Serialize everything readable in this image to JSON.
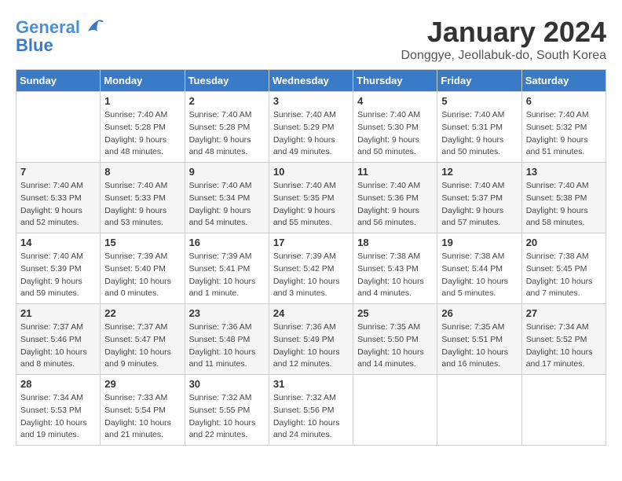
{
  "header": {
    "logo_line1": "General",
    "logo_line2": "Blue",
    "month_title": "January 2024",
    "subtitle": "Donggye, Jeollabuk-do, South Korea"
  },
  "weekdays": [
    "Sunday",
    "Monday",
    "Tuesday",
    "Wednesday",
    "Thursday",
    "Friday",
    "Saturday"
  ],
  "weeks": [
    [
      {
        "day": "",
        "sunrise": "",
        "sunset": "",
        "daylight": ""
      },
      {
        "day": "1",
        "sunrise": "Sunrise: 7:40 AM",
        "sunset": "Sunset: 5:28 PM",
        "daylight": "Daylight: 9 hours and 48 minutes."
      },
      {
        "day": "2",
        "sunrise": "Sunrise: 7:40 AM",
        "sunset": "Sunset: 5:28 PM",
        "daylight": "Daylight: 9 hours and 48 minutes."
      },
      {
        "day": "3",
        "sunrise": "Sunrise: 7:40 AM",
        "sunset": "Sunset: 5:29 PM",
        "daylight": "Daylight: 9 hours and 49 minutes."
      },
      {
        "day": "4",
        "sunrise": "Sunrise: 7:40 AM",
        "sunset": "Sunset: 5:30 PM",
        "daylight": "Daylight: 9 hours and 50 minutes."
      },
      {
        "day": "5",
        "sunrise": "Sunrise: 7:40 AM",
        "sunset": "Sunset: 5:31 PM",
        "daylight": "Daylight: 9 hours and 50 minutes."
      },
      {
        "day": "6",
        "sunrise": "Sunrise: 7:40 AM",
        "sunset": "Sunset: 5:32 PM",
        "daylight": "Daylight: 9 hours and 51 minutes."
      }
    ],
    [
      {
        "day": "7",
        "sunrise": "Sunrise: 7:40 AM",
        "sunset": "Sunset: 5:33 PM",
        "daylight": "Daylight: 9 hours and 52 minutes."
      },
      {
        "day": "8",
        "sunrise": "Sunrise: 7:40 AM",
        "sunset": "Sunset: 5:33 PM",
        "daylight": "Daylight: 9 hours and 53 minutes."
      },
      {
        "day": "9",
        "sunrise": "Sunrise: 7:40 AM",
        "sunset": "Sunset: 5:34 PM",
        "daylight": "Daylight: 9 hours and 54 minutes."
      },
      {
        "day": "10",
        "sunrise": "Sunrise: 7:40 AM",
        "sunset": "Sunset: 5:35 PM",
        "daylight": "Daylight: 9 hours and 55 minutes."
      },
      {
        "day": "11",
        "sunrise": "Sunrise: 7:40 AM",
        "sunset": "Sunset: 5:36 PM",
        "daylight": "Daylight: 9 hours and 56 minutes."
      },
      {
        "day": "12",
        "sunrise": "Sunrise: 7:40 AM",
        "sunset": "Sunset: 5:37 PM",
        "daylight": "Daylight: 9 hours and 57 minutes."
      },
      {
        "day": "13",
        "sunrise": "Sunrise: 7:40 AM",
        "sunset": "Sunset: 5:38 PM",
        "daylight": "Daylight: 9 hours and 58 minutes."
      }
    ],
    [
      {
        "day": "14",
        "sunrise": "Sunrise: 7:40 AM",
        "sunset": "Sunset: 5:39 PM",
        "daylight": "Daylight: 9 hours and 59 minutes."
      },
      {
        "day": "15",
        "sunrise": "Sunrise: 7:39 AM",
        "sunset": "Sunset: 5:40 PM",
        "daylight": "Daylight: 10 hours and 0 minutes."
      },
      {
        "day": "16",
        "sunrise": "Sunrise: 7:39 AM",
        "sunset": "Sunset: 5:41 PM",
        "daylight": "Daylight: 10 hours and 1 minute."
      },
      {
        "day": "17",
        "sunrise": "Sunrise: 7:39 AM",
        "sunset": "Sunset: 5:42 PM",
        "daylight": "Daylight: 10 hours and 3 minutes."
      },
      {
        "day": "18",
        "sunrise": "Sunrise: 7:38 AM",
        "sunset": "Sunset: 5:43 PM",
        "daylight": "Daylight: 10 hours and 4 minutes."
      },
      {
        "day": "19",
        "sunrise": "Sunrise: 7:38 AM",
        "sunset": "Sunset: 5:44 PM",
        "daylight": "Daylight: 10 hours and 5 minutes."
      },
      {
        "day": "20",
        "sunrise": "Sunrise: 7:38 AM",
        "sunset": "Sunset: 5:45 PM",
        "daylight": "Daylight: 10 hours and 7 minutes."
      }
    ],
    [
      {
        "day": "21",
        "sunrise": "Sunrise: 7:37 AM",
        "sunset": "Sunset: 5:46 PM",
        "daylight": "Daylight: 10 hours and 8 minutes."
      },
      {
        "day": "22",
        "sunrise": "Sunrise: 7:37 AM",
        "sunset": "Sunset: 5:47 PM",
        "daylight": "Daylight: 10 hours and 9 minutes."
      },
      {
        "day": "23",
        "sunrise": "Sunrise: 7:36 AM",
        "sunset": "Sunset: 5:48 PM",
        "daylight": "Daylight: 10 hours and 11 minutes."
      },
      {
        "day": "24",
        "sunrise": "Sunrise: 7:36 AM",
        "sunset": "Sunset: 5:49 PM",
        "daylight": "Daylight: 10 hours and 12 minutes."
      },
      {
        "day": "25",
        "sunrise": "Sunrise: 7:35 AM",
        "sunset": "Sunset: 5:50 PM",
        "daylight": "Daylight: 10 hours and 14 minutes."
      },
      {
        "day": "26",
        "sunrise": "Sunrise: 7:35 AM",
        "sunset": "Sunset: 5:51 PM",
        "daylight": "Daylight: 10 hours and 16 minutes."
      },
      {
        "day": "27",
        "sunrise": "Sunrise: 7:34 AM",
        "sunset": "Sunset: 5:52 PM",
        "daylight": "Daylight: 10 hours and 17 minutes."
      }
    ],
    [
      {
        "day": "28",
        "sunrise": "Sunrise: 7:34 AM",
        "sunset": "Sunset: 5:53 PM",
        "daylight": "Daylight: 10 hours and 19 minutes."
      },
      {
        "day": "29",
        "sunrise": "Sunrise: 7:33 AM",
        "sunset": "Sunset: 5:54 PM",
        "daylight": "Daylight: 10 hours and 21 minutes."
      },
      {
        "day": "30",
        "sunrise": "Sunrise: 7:32 AM",
        "sunset": "Sunset: 5:55 PM",
        "daylight": "Daylight: 10 hours and 22 minutes."
      },
      {
        "day": "31",
        "sunrise": "Sunrise: 7:32 AM",
        "sunset": "Sunset: 5:56 PM",
        "daylight": "Daylight: 10 hours and 24 minutes."
      },
      {
        "day": "",
        "sunrise": "",
        "sunset": "",
        "daylight": ""
      },
      {
        "day": "",
        "sunrise": "",
        "sunset": "",
        "daylight": ""
      },
      {
        "day": "",
        "sunrise": "",
        "sunset": "",
        "daylight": ""
      }
    ]
  ]
}
